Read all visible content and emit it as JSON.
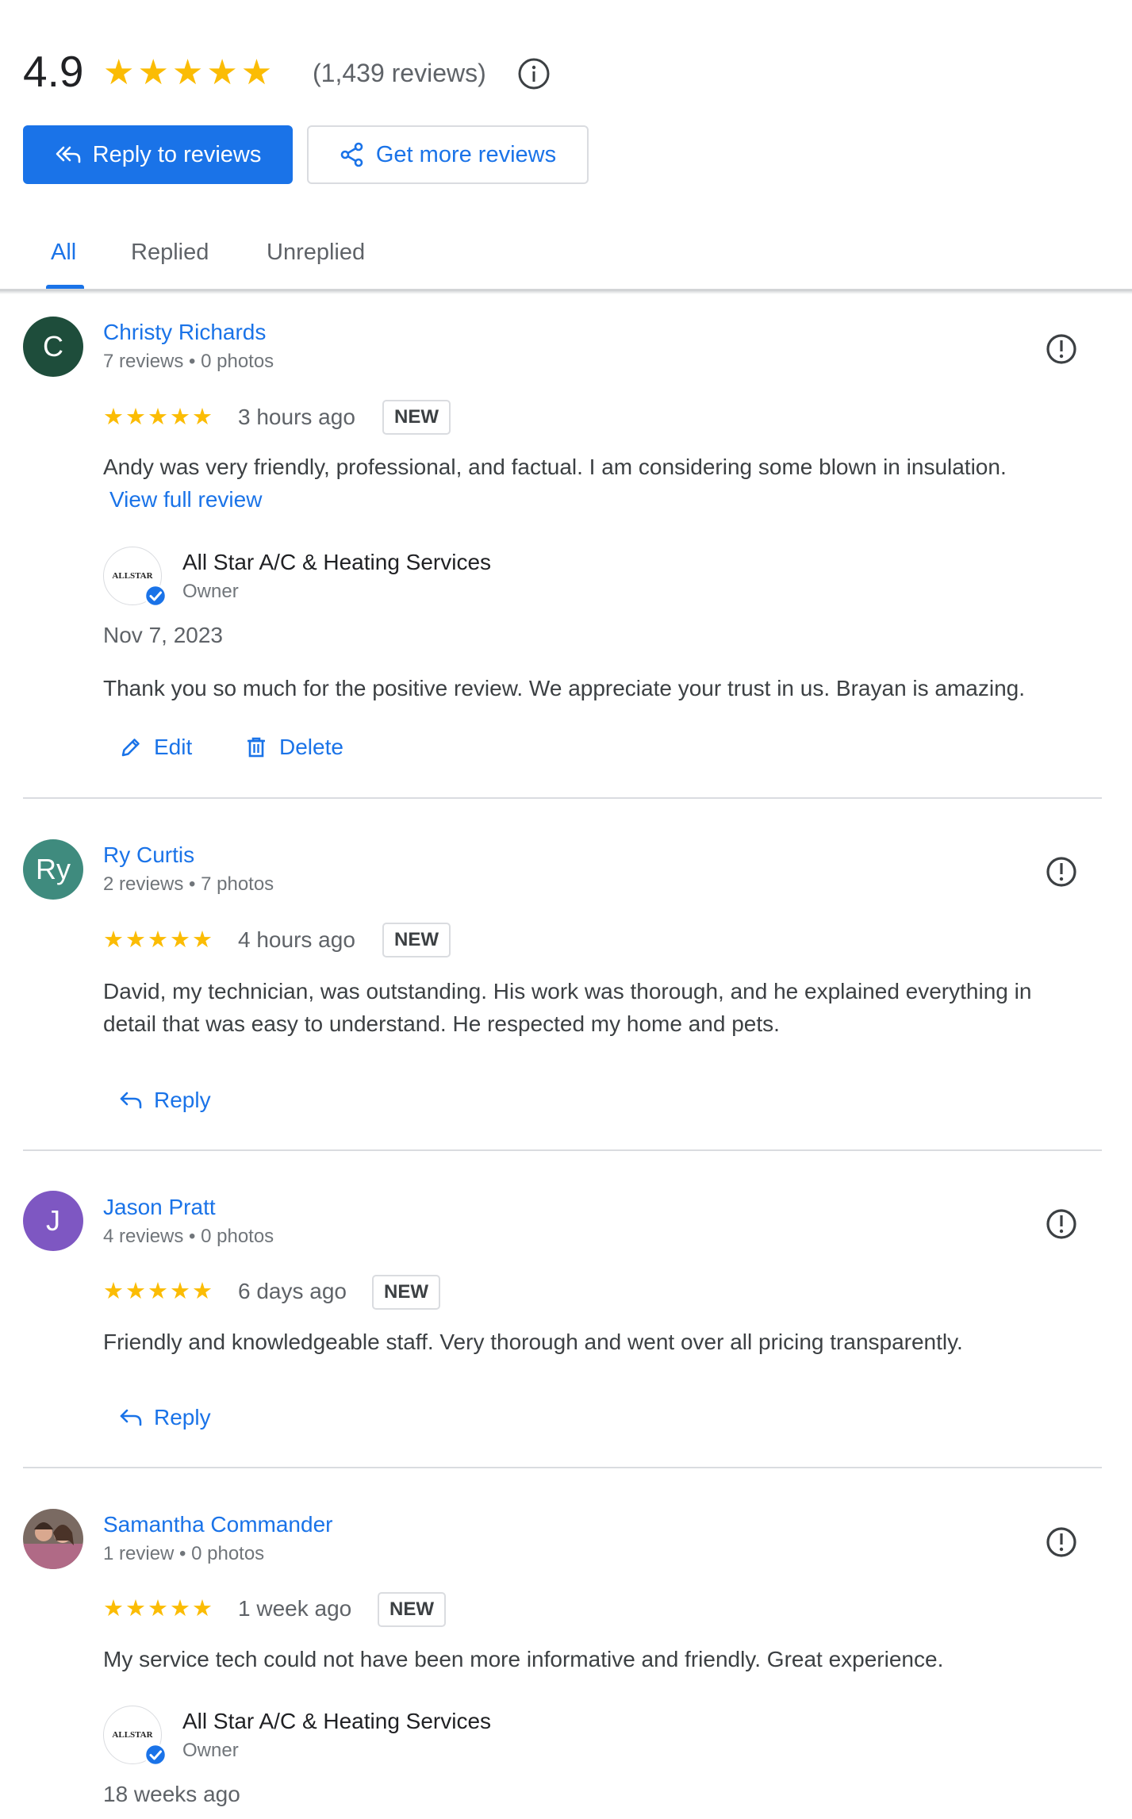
{
  "summary": {
    "rating": "4.9",
    "stars": "★★★★★",
    "count": "(1,439 reviews)",
    "info_icon": "info-icon"
  },
  "buttons": {
    "reply_to_reviews": "Reply to reviews",
    "get_more_reviews": "Get more reviews"
  },
  "tabs": [
    {
      "label": "All",
      "active": true
    },
    {
      "label": "Replied",
      "active": false
    },
    {
      "label": "Unreplied",
      "active": false
    }
  ],
  "colors": {
    "accent": "#1a73e8",
    "star": "#fbbc04",
    "avatar_c": "#1e4d3b",
    "avatar_ry": "#3f8b7e",
    "avatar_j": "#7e57c2"
  },
  "reviews": [
    {
      "initials": "C",
      "name": "Christy Richards",
      "meta": "7 reviews • 0 photos",
      "rating": 5,
      "stars": "★★★★★",
      "time": "3 hours ago",
      "badge": "NEW",
      "text": "Andy was very friendly, professional, and factual. I am considering some blown in insulation.",
      "view_full": "View full review",
      "owner_reply": {
        "logo_text": "ALLSTAR",
        "business": "All Star A/C & Heating Services",
        "role": "Owner",
        "date": "Nov 7, 2023",
        "text": "Thank you so much for the positive review. We appreciate your trust in us. Brayan is amazing.",
        "edit": "Edit",
        "delete": "Delete"
      }
    },
    {
      "initials": "Ry",
      "name": "Ry Curtis",
      "meta": "2 reviews • 7 photos",
      "rating": 5,
      "stars": "★★★★★",
      "time": "4 hours ago",
      "badge": "NEW",
      "text_line1": "David, my technician, was outstanding. His work was thorough, and he explained everything in",
      "text_line2": "detail that was easy to understand. He respected my home and pets.",
      "reply": "Reply"
    },
    {
      "initials": "J",
      "name": "Jason Pratt",
      "meta": "4 reviews • 0 photos",
      "rating": 5,
      "stars": "★★★★★",
      "time": "6 days ago",
      "badge": "NEW",
      "text": "Friendly and knowledgeable staff. Very thorough and went over all pricing transparently.",
      "reply": "Reply"
    },
    {
      "name": "Samantha Commander",
      "meta": "1 review • 0 photos",
      "rating": 5,
      "stars": "★★★★★",
      "time": "1 week ago",
      "badge": "NEW",
      "text": "My service tech could not have been more informative and friendly. Great experience.",
      "owner_reply": {
        "logo_text": "ALLSTAR",
        "business": "All Star A/C & Heating Services",
        "role": "Owner",
        "date": "18 weeks ago"
      }
    }
  ]
}
